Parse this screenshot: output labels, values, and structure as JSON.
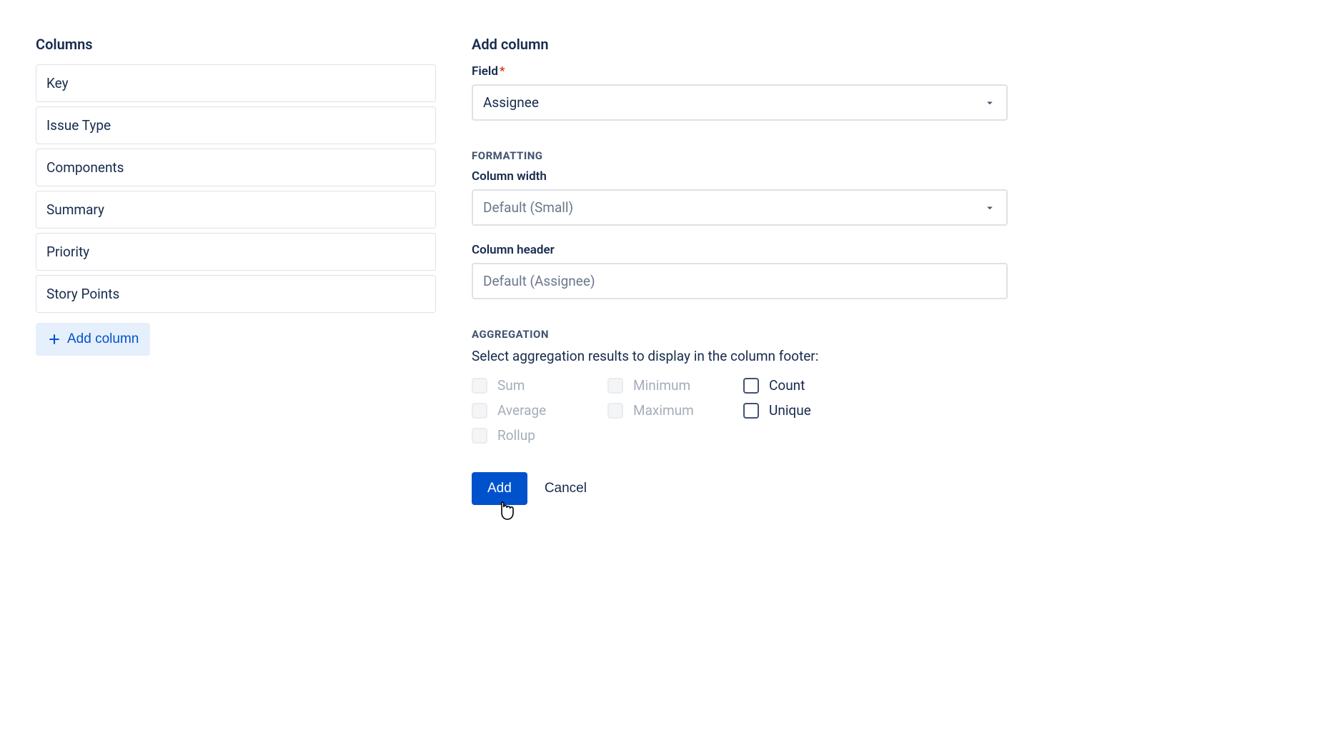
{
  "left": {
    "title": "Columns",
    "items": [
      "Key",
      "Issue Type",
      "Components",
      "Summary",
      "Priority",
      "Story Points"
    ],
    "add_label": "Add column"
  },
  "right": {
    "title": "Add column",
    "field_label": "Field",
    "field_value": "Assignee",
    "formatting_label": "FORMATTING",
    "width_label": "Column width",
    "width_value": "Default (Small)",
    "header_label": "Column header",
    "header_placeholder": "Default (Assignee)",
    "aggregation_label": "AGGREGATION",
    "aggregation_desc": "Select aggregation results to display in the column footer:",
    "agg_options": [
      {
        "label": "Sum",
        "enabled": false
      },
      {
        "label": "Minimum",
        "enabled": false
      },
      {
        "label": "Count",
        "enabled": true
      },
      {
        "label": "Average",
        "enabled": false
      },
      {
        "label": "Maximum",
        "enabled": false
      },
      {
        "label": "Unique",
        "enabled": true
      },
      {
        "label": "Rollup",
        "enabled": false
      }
    ],
    "add_button": "Add",
    "cancel_button": "Cancel"
  }
}
